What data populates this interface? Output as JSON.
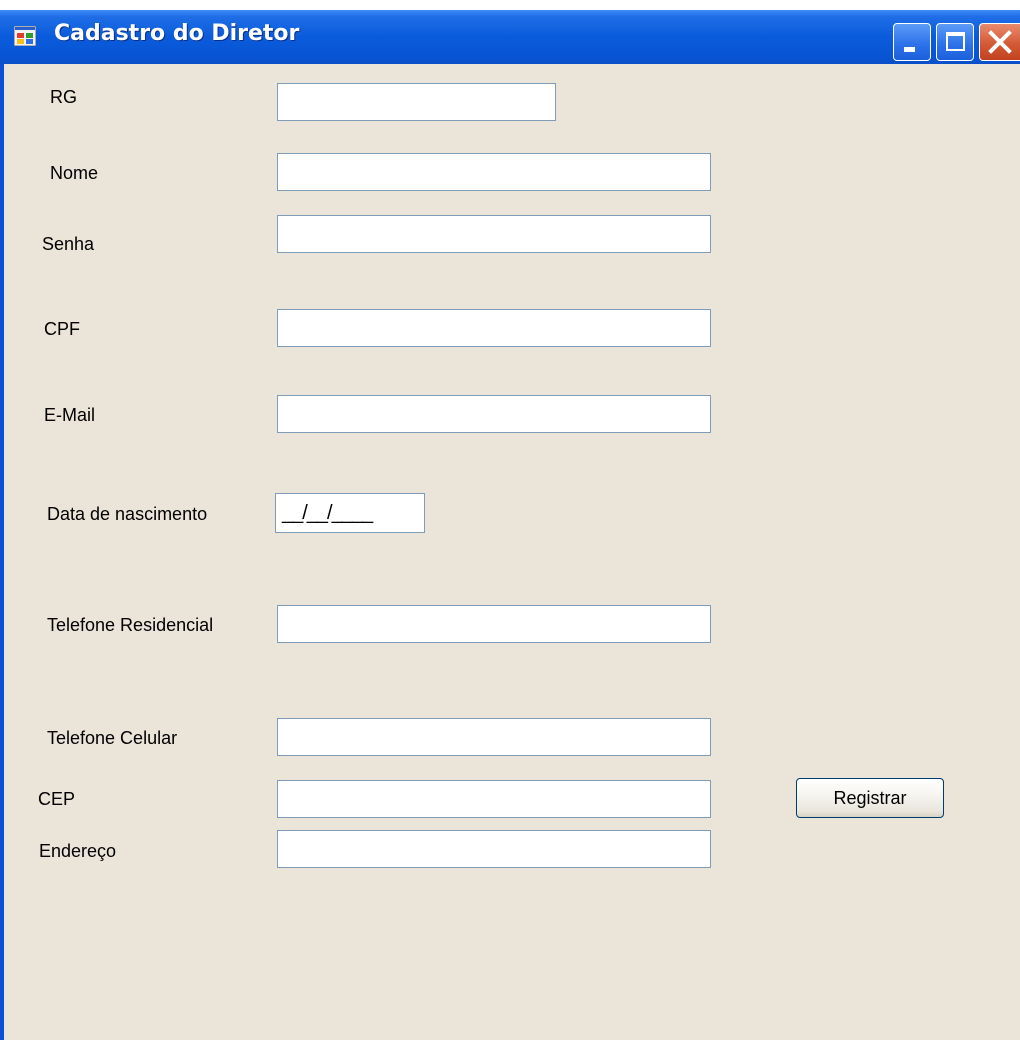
{
  "window": {
    "title": "Cadastro do Diretor"
  },
  "title_buttons": {
    "minimize": "minimize-icon",
    "maximize": "maximize-icon",
    "close": "close-icon"
  },
  "fields": {
    "rg": {
      "label": "RG",
      "value": ""
    },
    "nome": {
      "label": "Nome",
      "value": ""
    },
    "senha": {
      "label": "Senha",
      "value": ""
    },
    "cpf": {
      "label": "CPF",
      "value": ""
    },
    "email": {
      "label": "E-Mail",
      "value": ""
    },
    "data_nascimento": {
      "label": "Data de nascimento",
      "mask": "__/__/____"
    },
    "tel_residencial": {
      "label": "Telefone Residencial",
      "value": ""
    },
    "tel_celular": {
      "label": "Telefone Celular",
      "value": ""
    },
    "endereco": {
      "label": "Endereço",
      "value": ""
    },
    "cep": {
      "label": "CEP",
      "value": ""
    }
  },
  "actions": {
    "register_label": "Registrar"
  },
  "colors": {
    "titlebar": "#0a5bdc",
    "form_background": "#ebe4d8",
    "field_border": "#7f9db9",
    "close_button": "#d45a36"
  }
}
